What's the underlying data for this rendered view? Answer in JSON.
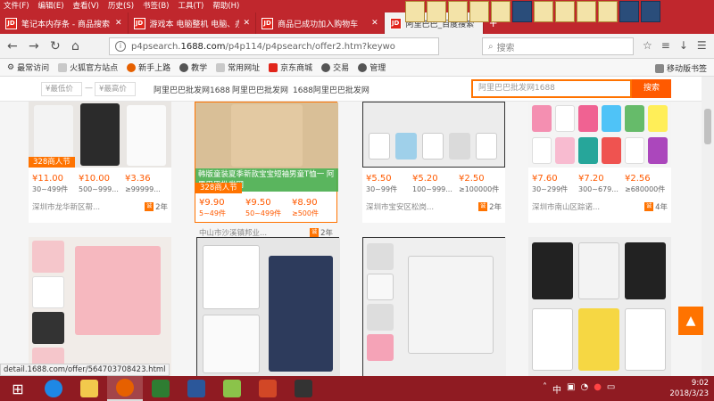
{
  "menu": [
    "文件(F)",
    "编辑(E)",
    "查看(V)",
    "历史(S)",
    "书签(B)",
    "工具(T)",
    "帮助(H)"
  ],
  "tabs": [
    {
      "icon": "JD",
      "title": "笔记本内存条 - 商品搜索 - 京",
      "active": false
    },
    {
      "icon": "JD",
      "title": "游戏本 电脑整机 电脑、办公",
      "active": false
    },
    {
      "icon": "JD",
      "title": "商品已成功加入购物车",
      "active": false
    },
    {
      "icon": "JD",
      "title": "阿里巴巴_百度搜索",
      "active": true
    }
  ],
  "tools": [
    "",
    "",
    "",
    "",
    "",
    "",
    "",
    "",
    "",
    "",
    "",
    ""
  ],
  "nav": {
    "url_prefix": "p4psearch.",
    "url_domain": "1688.com",
    "url_suffix": "/p4p114/p4psearch/offer2.htm?keywo",
    "search_placeholder": "搜索"
  },
  "bookmarks": [
    "最常访问",
    "火狐官方站点",
    "新手上路",
    "教学",
    "常用网址",
    "京东商城",
    "交易",
    "管理"
  ],
  "bookmark_mobile": "移动版书签",
  "filter": {
    "min_price": "¥最低价",
    "dash": "—",
    "max_price": "¥最高价",
    "links": [
      "阿里巴巴批发网1688",
      "阿里巴巴批发网",
      "1688阿里巴巴批发网"
    ],
    "search_value": "阿里巴巴批发网1688",
    "search_button": "搜索"
  },
  "products_row1": [
    {
      "badge": "328商人节",
      "prices": [
        {
          "v": "¥11.00",
          "q": "30~499件"
        },
        {
          "v": "¥10.00",
          "q": "500~999..."
        },
        {
          "v": "¥3.36",
          "q": "≥99999..."
        }
      ],
      "location": "深圳市龙华新区帮...",
      "years": "2年"
    },
    {
      "badge": "328商人节",
      "banner": "韩版童装夏季新款宝宝短袖男童T恤一 阿里巴巴批发网",
      "prices": [
        {
          "v": "¥9.90",
          "q": "5~49件"
        },
        {
          "v": "¥9.50",
          "q": "50~499件"
        },
        {
          "v": "¥8.90",
          "q": "≥500件"
        }
      ],
      "location": "中山市沙溪镇邦业...",
      "years": "2年"
    },
    {
      "prices": [
        {
          "v": "¥5.50",
          "q": "30~99件"
        },
        {
          "v": "¥5.20",
          "q": "100~999..."
        },
        {
          "v": "¥2.50",
          "q": "≥100000件"
        }
      ],
      "location": "深圳市宝安区松岗...",
      "years": "2年"
    },
    {
      "prices": [
        {
          "v": "¥7.60",
          "q": "30~299件"
        },
        {
          "v": "¥7.20",
          "q": "300~679..."
        },
        {
          "v": "¥2.56",
          "q": "≥680000件"
        }
      ],
      "location": "深圳市南山区踪诺...",
      "years": "4年"
    }
  ],
  "status_url": "detail.1688.com/offer/564703708423.html",
  "taskbar": {
    "time": "9:02",
    "date": "2018/3/23",
    "tray_text": "中"
  },
  "colors": {
    "titlebar": "#c0272d",
    "accent": "#ff7300",
    "taskbar": "#8f1b22"
  }
}
